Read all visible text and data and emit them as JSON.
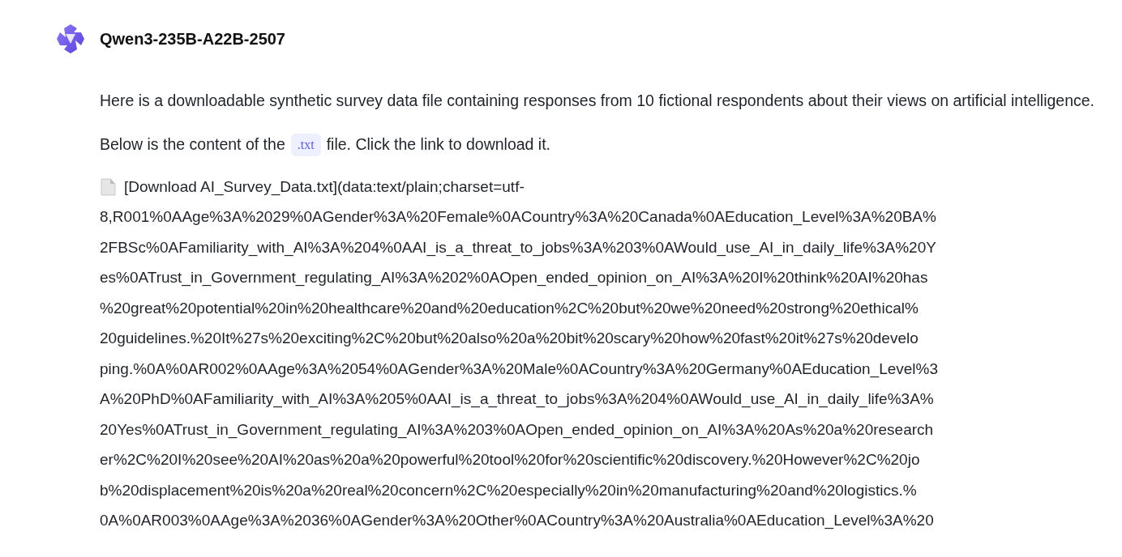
{
  "message": {
    "author": "Qwen3-235B-A22B-2507",
    "paragraphs": [
      {
        "kind": "text",
        "text": "Here is a downloadable synthetic survey data file containing responses from 10 fictional respondents about their views on artificial intelligence."
      },
      {
        "kind": "code",
        "before": "Below is the content of the",
        "code": ".txt",
        "after": "file. Click the link to download it."
      }
    ],
    "link_lines": [
      "[Download AI_Survey_Data.txt](data:text/plain;charset=utf-",
      "8,R001%0AAge%3A%2029%0AGender%3A%20Female%0ACountry%3A%20Canada%0AEducation_Level%3A%20BA%",
      "2FBSc%0AFamiliarity_with_AI%3A%204%0AAI_is_a_threat_to_jobs%3A%203%0AWould_use_AI_in_daily_life%3A%20Y",
      "es%0ATrust_in_Government_regulating_AI%3A%202%0AOpen_ended_opinion_on_AI%3A%20I%20think%20AI%20has",
      "%20great%20potential%20in%20healthcare%20and%20education%2C%20but%20we%20need%20strong%20ethical%",
      "20guidelines.%20It%27s%20exciting%2C%20but%20also%20a%20bit%20scary%20how%20fast%20it%27s%20develo",
      "ping.%0A%0AR002%0AAge%3A%2054%0AGender%3A%20Male%0ACountry%3A%20Germany%0AEducation_Level%3",
      "A%20PhD%0AFamiliarity_with_AI%3A%205%0AAI_is_a_threat_to_jobs%3A%204%0AWould_use_AI_in_daily_life%3A%",
      "20Yes%0ATrust_in_Government_regulating_AI%3A%203%0AOpen_ended_opinion_on_AI%3A%20As%20a%20research",
      "er%2C%20I%20see%20AI%20as%20a%20powerful%20tool%20for%20scientific%20discovery.%20However%2C%20jo",
      "b%20displacement%20is%20a%20real%20concern%2C%20especially%20in%20manufacturing%20and%20logistics.%",
      "0A%0AR003%0AAge%3A%2036%0AGender%3A%20Other%0ACountry%3A%20Australia%0AEducation_Level%3A%20"
    ]
  }
}
